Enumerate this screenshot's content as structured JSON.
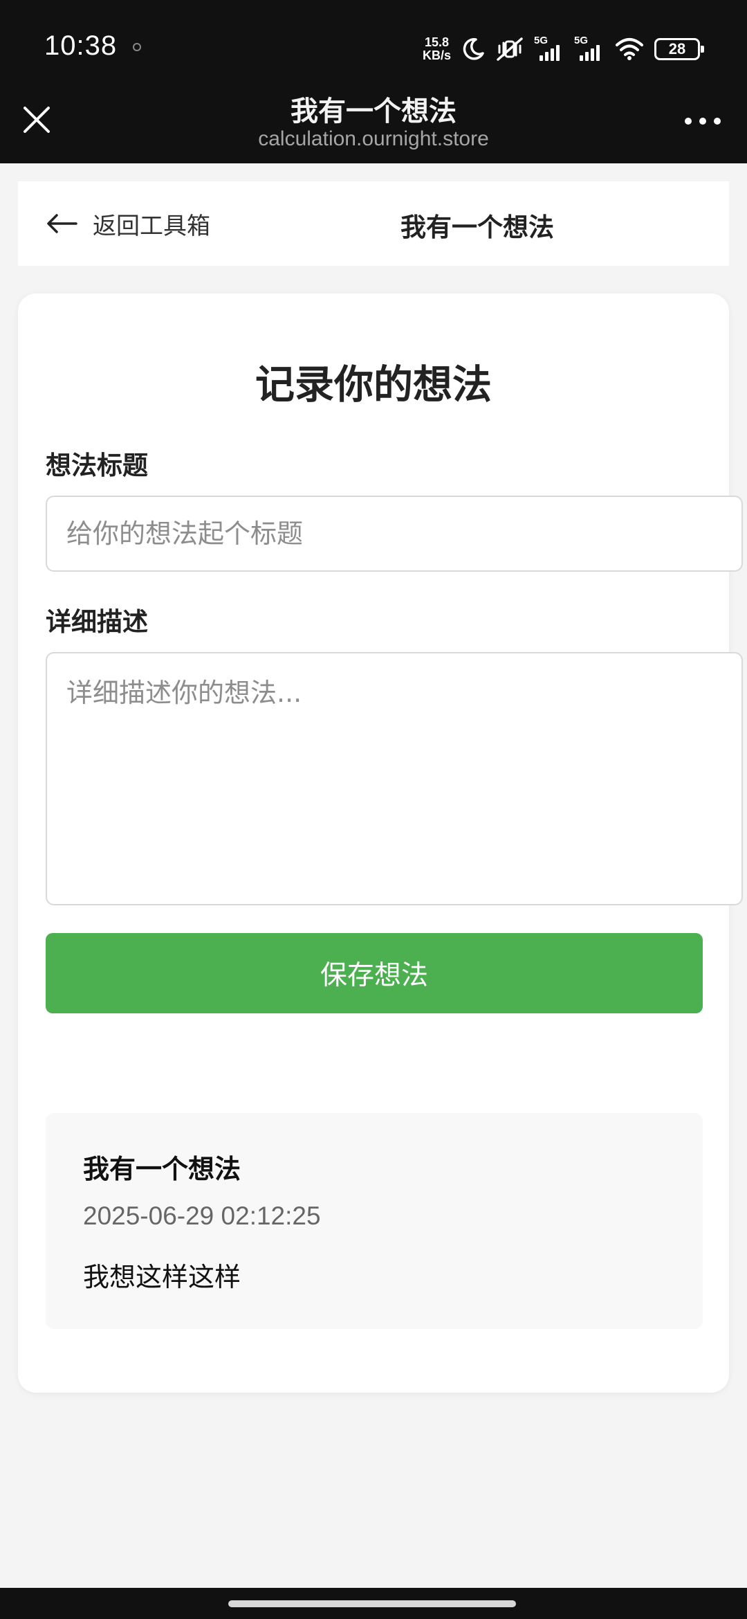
{
  "status_bar": {
    "time": "10:38",
    "net_speed_value": "15.8",
    "net_speed_unit": "KB/s",
    "signal_1_label": "5G",
    "signal_2_label": "5G",
    "battery": "28",
    "icons": [
      "moon-icon",
      "mute-vibrate-icon",
      "signal-icon",
      "wifi-icon",
      "battery-icon"
    ]
  },
  "browser": {
    "title": "我有一个想法",
    "url": "calculation.ournight.store"
  },
  "header": {
    "back_label": "返回工具箱",
    "title": "我有一个想法"
  },
  "form": {
    "heading": "记录你的想法",
    "title_label": "想法标题",
    "title_placeholder": "给你的想法起个标题",
    "title_value": "",
    "desc_label": "详细描述",
    "desc_placeholder": "详细描述你的想法...",
    "desc_value": "",
    "save_label": "保存想法"
  },
  "ideas": [
    {
      "title": "我有一个想法",
      "time": "2025-06-29 02:12:25",
      "description": "我想这样这样"
    }
  ],
  "colors": {
    "accent": "#4caf50",
    "top_bar": "#111111",
    "page_bg": "#f4f4f4"
  }
}
